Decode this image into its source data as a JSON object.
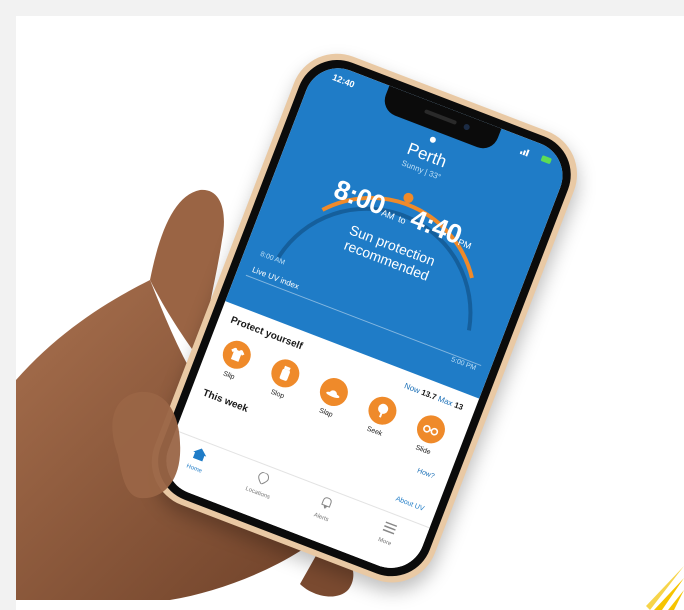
{
  "phone": {
    "status_time": "12:40",
    "location": "Perth",
    "weather": "Sunny | 33°",
    "protection": {
      "start_time": "8:00",
      "start_suffix": "AM",
      "joiner": "to",
      "end_time": "4:40",
      "end_suffix": "PM",
      "message_line1": "Sun protection",
      "message_line2": "recommended",
      "arc_start_label": "8:00 AM",
      "arc_end_label": "5:00 PM"
    },
    "live_uv_label": "Live UV index",
    "protect_heading": "Protect yourself",
    "uv_now_label": "Now",
    "uv_now_value": "13.7",
    "uv_max_label": "Max",
    "uv_max_value": "13",
    "actions": [
      {
        "label": "Slip",
        "icon": "shirt-icon"
      },
      {
        "label": "Slop",
        "icon": "sunscreen-icon"
      },
      {
        "label": "Slap",
        "icon": "hat-icon"
      },
      {
        "label": "Seek",
        "icon": "shade-icon"
      },
      {
        "label": "Slide",
        "icon": "sunglasses-icon"
      }
    ],
    "how_to_label": "How?",
    "week_heading": "This week",
    "about_uv_label": "About UV",
    "tabs": [
      {
        "label": "Home",
        "icon": "home-icon",
        "active": true
      },
      {
        "label": "Locations",
        "icon": "location-pin-icon"
      },
      {
        "label": "Alerts",
        "icon": "bell-icon"
      },
      {
        "label": "More",
        "icon": "menu-icon"
      }
    ],
    "colors": {
      "screen_blue": "#1f7cc7",
      "accent_orange": "#ef8a2a",
      "phone_gold": "#e9c9a4"
    }
  }
}
